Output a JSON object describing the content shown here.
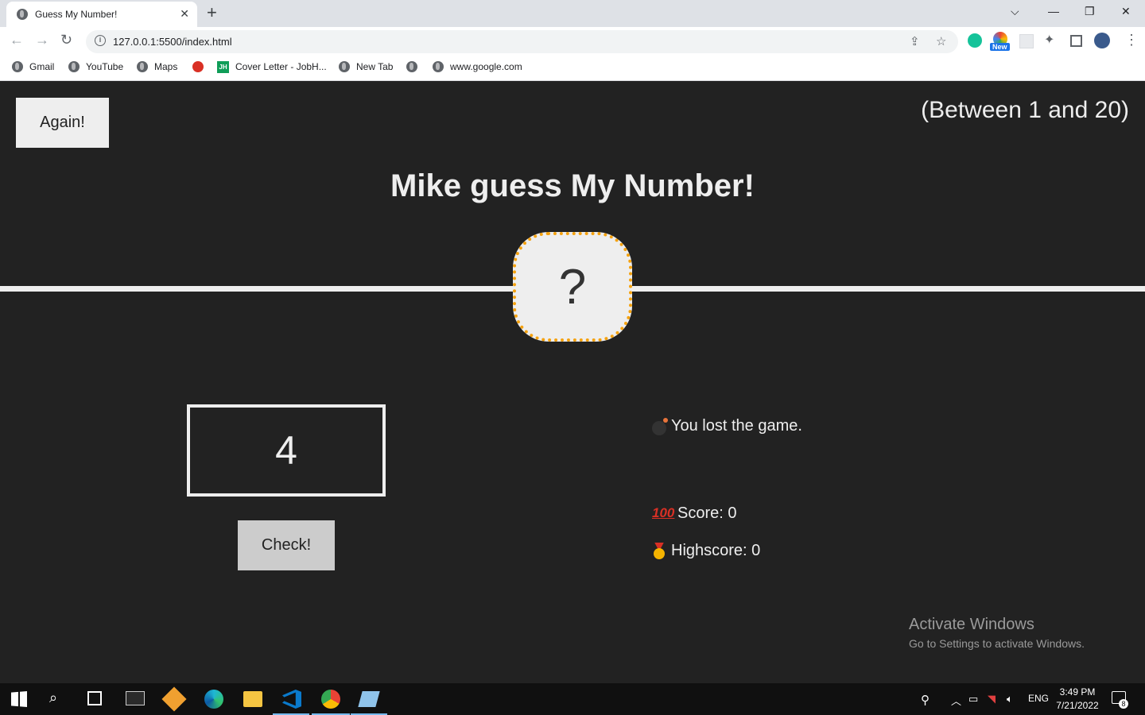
{
  "browser": {
    "tab_title": "Guess My Number!",
    "tab_close": "✕",
    "new_tab": "+",
    "url": "127.0.0.1:5500/index.html",
    "bookmarks": [
      {
        "label": "Gmail",
        "icon": "globe-icon"
      },
      {
        "label": "YouTube",
        "icon": "globe-icon"
      },
      {
        "label": "Maps",
        "icon": "globe-icon"
      },
      {
        "label": "",
        "icon": "red-dot-icon"
      },
      {
        "label": "Cover Letter - JobH...",
        "icon": "jobhire-icon"
      },
      {
        "label": "New Tab",
        "icon": "globe-icon"
      },
      {
        "label": "",
        "icon": "globe-icon"
      },
      {
        "label": "www.google.com",
        "icon": "globe-icon"
      }
    ],
    "extension_badge": "New"
  },
  "game": {
    "again_label": "Again!",
    "range_text": "(Between 1 and 20)",
    "title": "Mike guess My Number!",
    "secret": "?",
    "guess_value": "4",
    "check_label": "Check!",
    "message": "You lost the game.",
    "score_text": "Score: 0",
    "highscore_text": "Highscore: 0",
    "accent_color": "#f5a20f",
    "background_color": "#222222"
  },
  "watermark": {
    "line1": "Activate Windows",
    "line2": "Go to Settings to activate Windows."
  },
  "taskbar": {
    "language": "ENG",
    "time": "3:49 PM",
    "date": "7/21/2022",
    "notification_count": "8"
  }
}
